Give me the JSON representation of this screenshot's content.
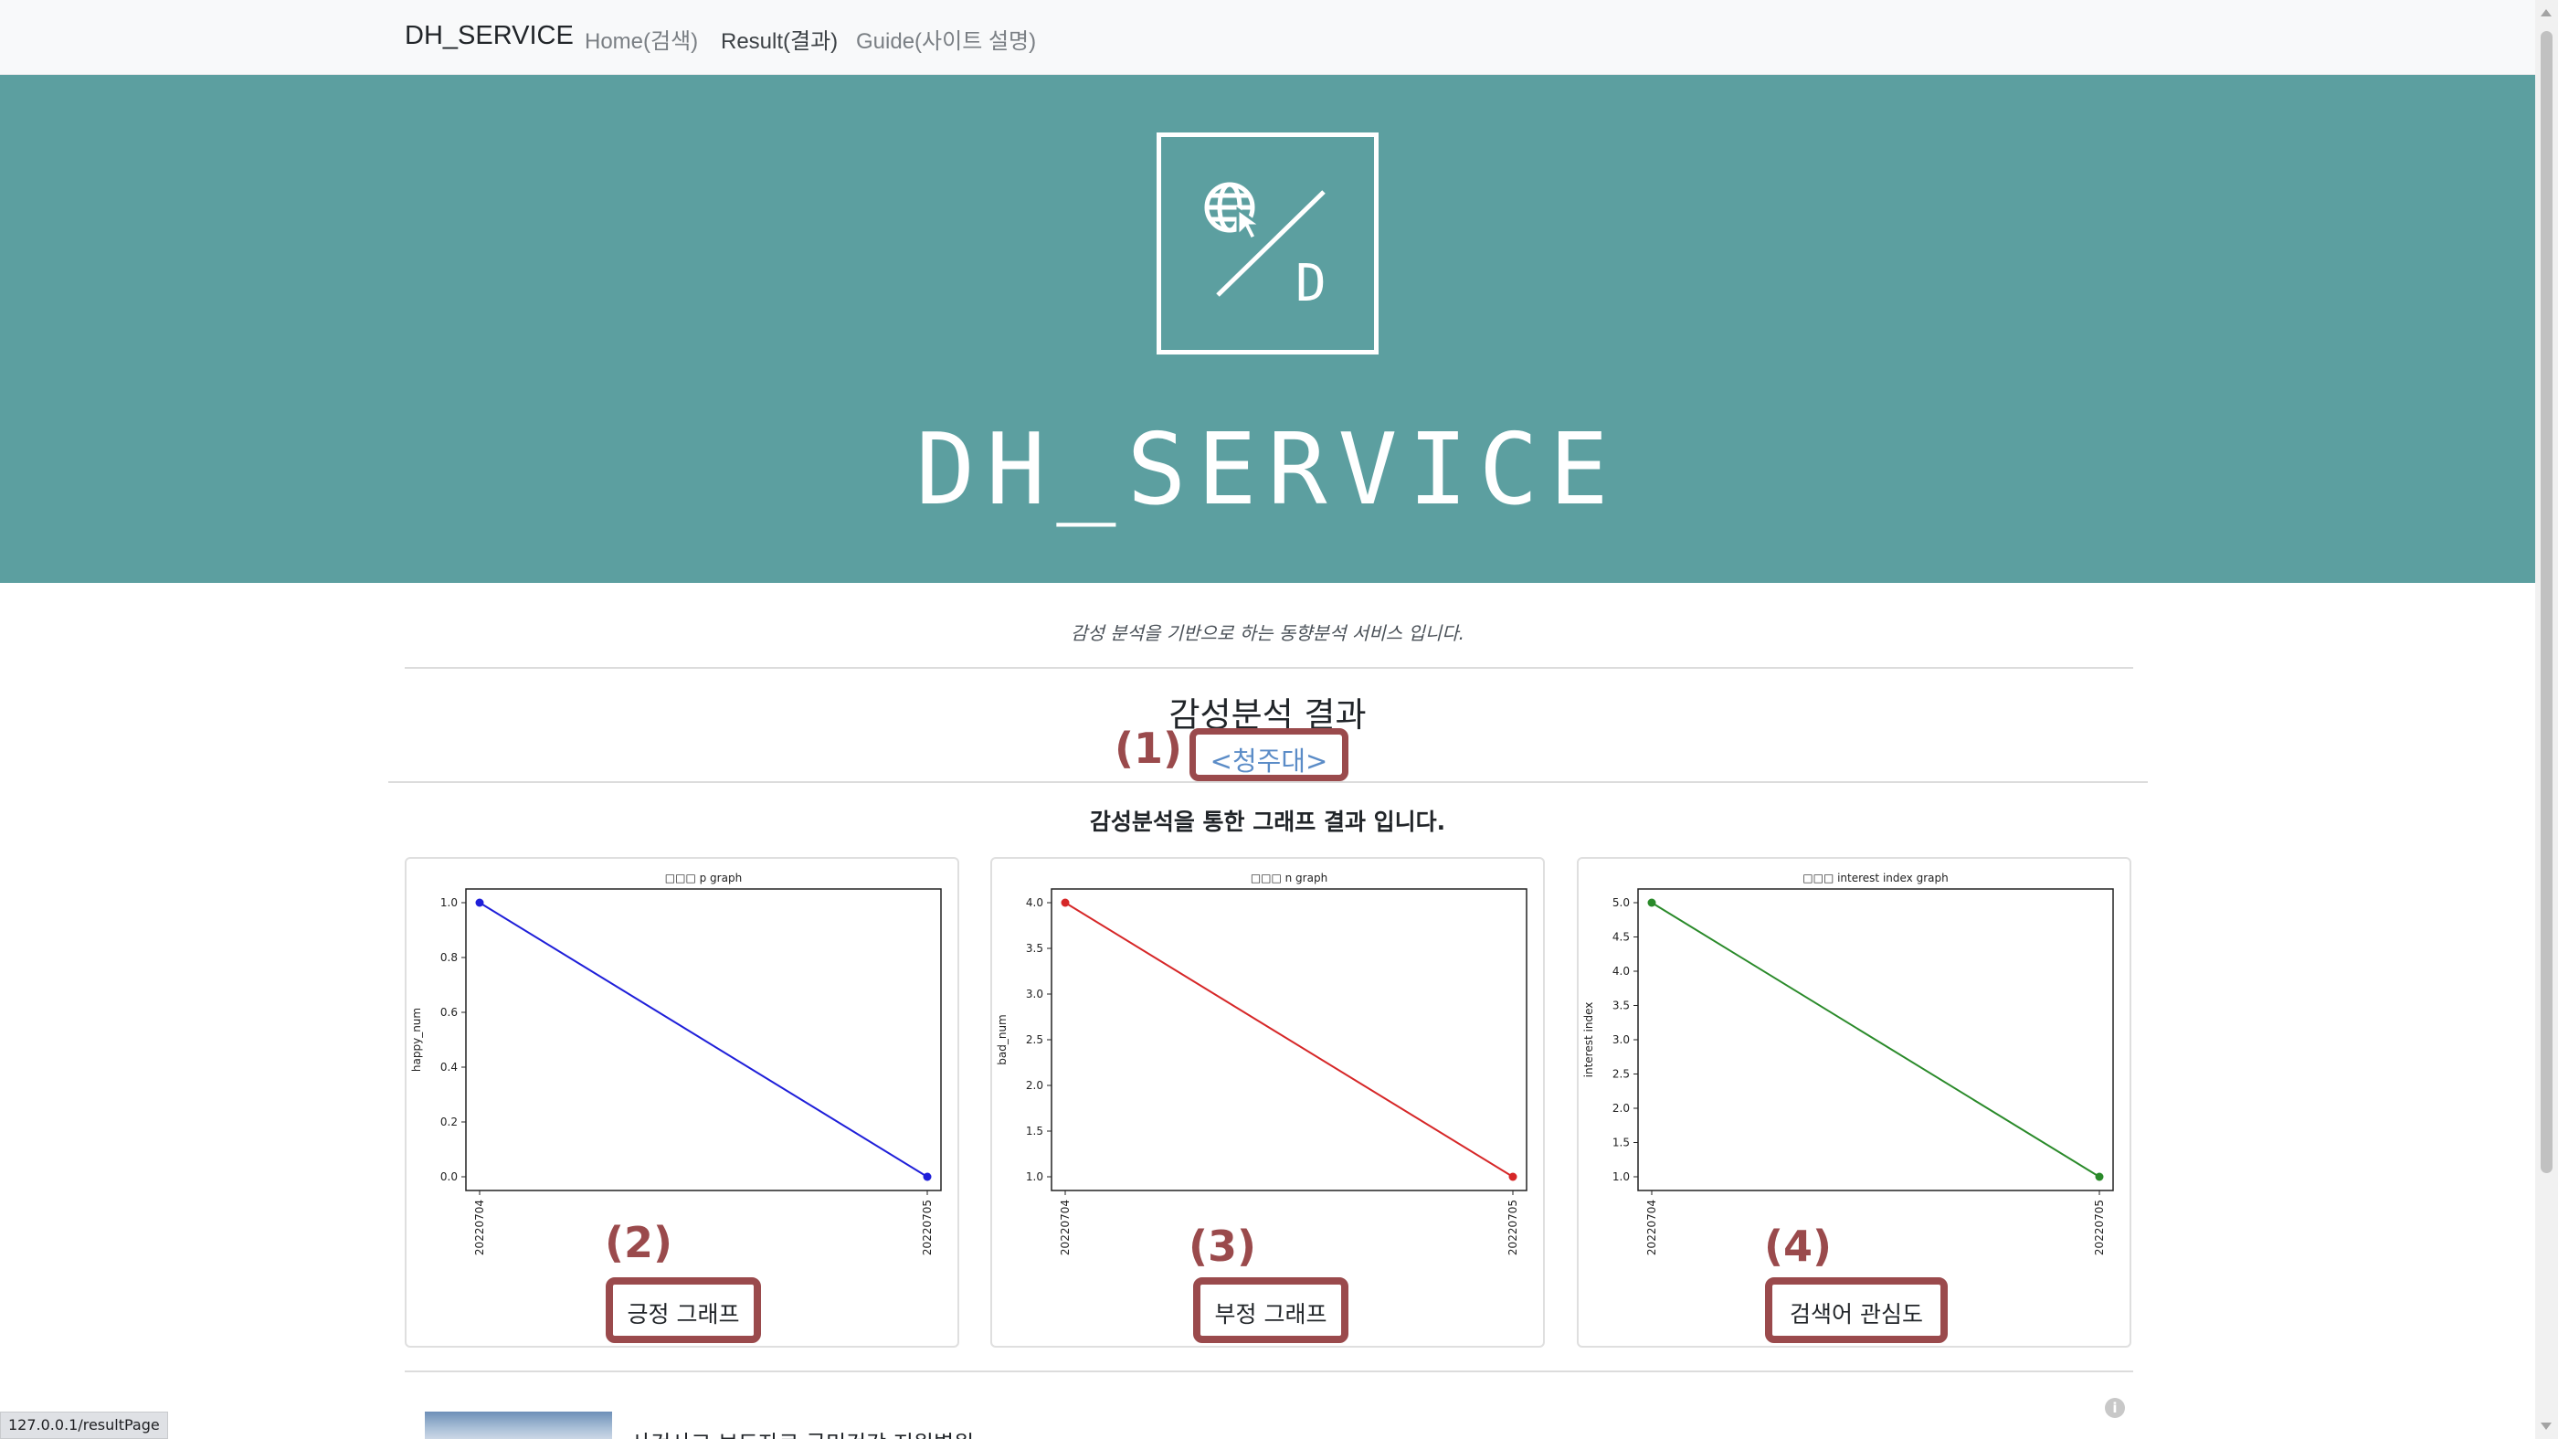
{
  "navbar": {
    "brand": "DH_SERVICE",
    "links": [
      {
        "label": "Home(검색)",
        "active": false
      },
      {
        "label": "Result(결과)",
        "active": true
      },
      {
        "label": "Guide(사이트 설명)",
        "active": false
      }
    ]
  },
  "hero": {
    "logo_letter": "D",
    "logo_icon": "globe-cursor-icon",
    "title": "DH_SERVICE",
    "background": "#5c9fa0"
  },
  "tagline": "감성 분석을 기반으로 하는 동향분석 서비스 입니다.",
  "result": {
    "heading": "감성분석 결과",
    "keyword": "<청주대>",
    "subtitle": "감성분석을 통한 그래프 결과 입니다."
  },
  "annotations": [
    "(1)",
    "(2)",
    "(3)",
    "(4)"
  ],
  "graphs": [
    {
      "button_label": "긍정 그래프"
    },
    {
      "button_label": "부정 그래프"
    },
    {
      "button_label": "검색어 관심도"
    }
  ],
  "chart_data": [
    {
      "type": "line",
      "title": "□□□ p graph",
      "xlabel": "",
      "ylabel": "happy_num",
      "categories": [
        "20220704",
        "20220705"
      ],
      "values": [
        1.0,
        0.0
      ],
      "ylim": [
        0.0,
        1.0
      ],
      "yticks": [
        "0.0",
        "0.2",
        "0.4",
        "0.6",
        "0.8",
        "1.0"
      ],
      "color": "#1f1fd9",
      "grid": false
    },
    {
      "type": "line",
      "title": "□□□ n graph",
      "xlabel": "",
      "ylabel": "bad_num",
      "categories": [
        "20220704",
        "20220705"
      ],
      "values": [
        4.0,
        1.0
      ],
      "ylim": [
        1.0,
        4.0
      ],
      "yticks": [
        "1.0",
        "1.5",
        "2.0",
        "2.5",
        "3.0",
        "3.5",
        "4.0"
      ],
      "color": "#d62728",
      "grid": false
    },
    {
      "type": "line",
      "title": "□□□ interest index graph",
      "xlabel": "",
      "ylabel": "interest index",
      "categories": [
        "20220704",
        "20220705"
      ],
      "values": [
        5.0,
        1.0
      ],
      "ylim": [
        1.0,
        5.0
      ],
      "yticks": [
        "1.0",
        "1.5",
        "2.0",
        "2.5",
        "3.0",
        "3.5",
        "4.0",
        "4.5",
        "5.0"
      ],
      "color": "#2a8a2a",
      "grid": false
    }
  ],
  "news": {
    "headline_partial": "사건사고 보도자료 국민건강 지원병원"
  },
  "status_bar": {
    "url": "127.0.0.1/resultPage"
  }
}
